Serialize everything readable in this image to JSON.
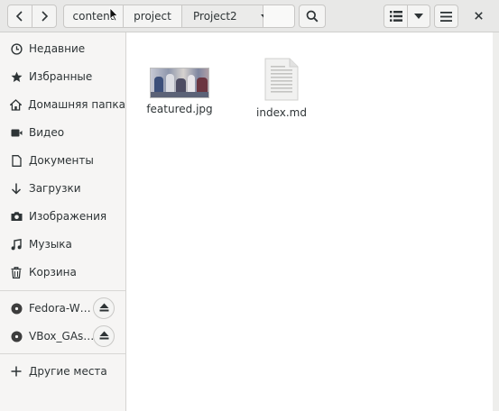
{
  "header": {
    "breadcrumbs": [
      "content",
      "project",
      "Project2"
    ],
    "icons": {
      "back": "chevron-left-icon",
      "forward": "chevron-right-icon",
      "dropdown": "triangle-down-icon",
      "search": "search-icon",
      "view": "list-view-icon",
      "view_menu": "triangle-down-icon",
      "menu": "hamburger-menu-icon",
      "close": "close-icon"
    }
  },
  "sidebar": {
    "places": [
      {
        "label": "Недавние",
        "icon": "recent-clock-icon"
      },
      {
        "label": "Избранные",
        "icon": "star-icon"
      },
      {
        "label": "Домашняя папка",
        "icon": "home-icon"
      },
      {
        "label": "Видео",
        "icon": "video-icon"
      },
      {
        "label": "Документы",
        "icon": "document-icon"
      },
      {
        "label": "Загрузки",
        "icon": "download-arrow-icon"
      },
      {
        "label": "Изображения",
        "icon": "camera-icon"
      },
      {
        "label": "Музыка",
        "icon": "music-note-icon"
      },
      {
        "label": "Корзина",
        "icon": "trash-icon"
      }
    ],
    "devices": [
      {
        "label": "Fedora-W…",
        "icon": "disc-icon",
        "action_icon": "eject-icon"
      },
      {
        "label": "VBox_GAs…",
        "icon": "disc-icon",
        "action_icon": "eject-icon"
      }
    ],
    "other": {
      "label": "Другие места",
      "icon": "plus-icon"
    }
  },
  "files": [
    {
      "name": "featured.jpg",
      "icon": "image-thumbnail"
    },
    {
      "name": "index.md",
      "icon": "text-document-icon"
    }
  ],
  "colors": {
    "header_bg": "#e8e8e7",
    "sidebar_bg": "#f6f5f4",
    "main_bg": "#ffffff",
    "text": "#2e3436"
  }
}
